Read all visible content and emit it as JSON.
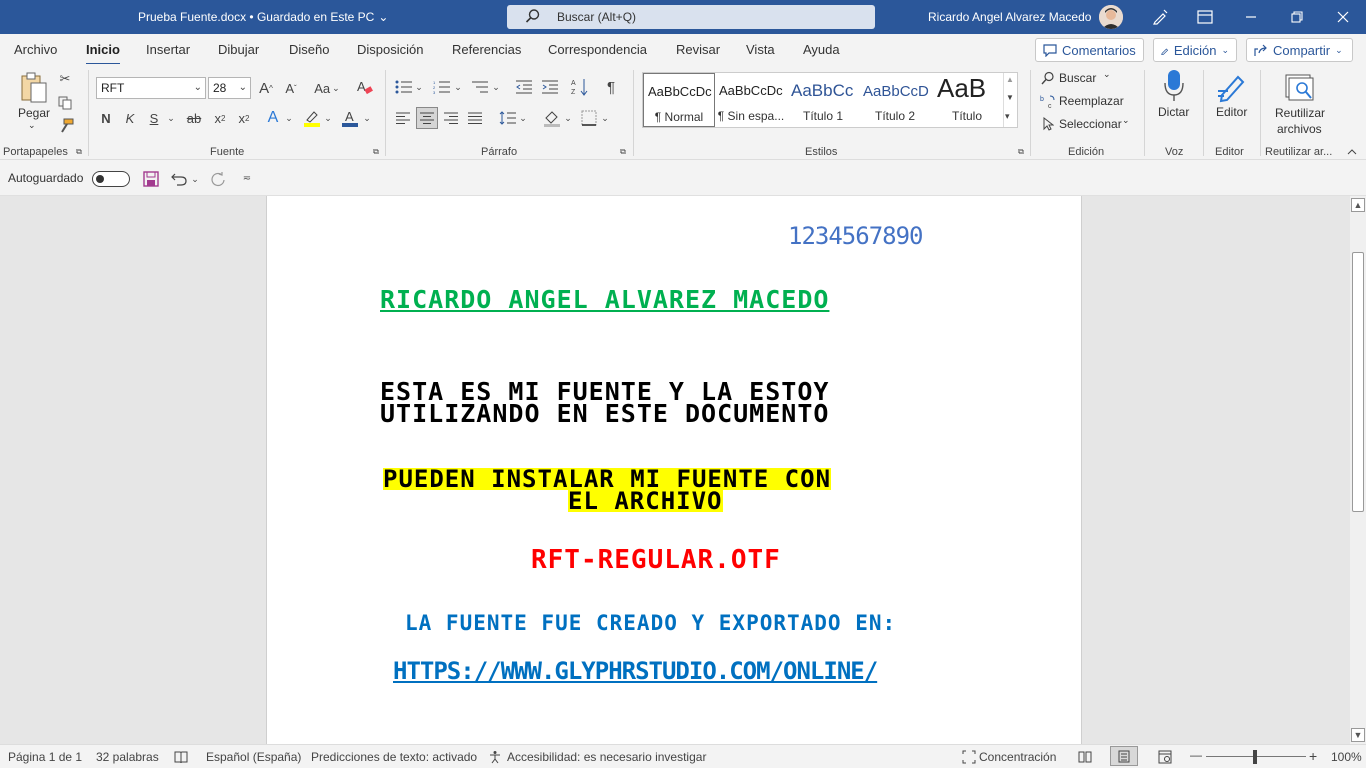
{
  "titlebar": {
    "doc_title": "Prueba Fuente.docx  •  Guardado en Este PC",
    "search_placeholder": "Buscar (Alt+Q)",
    "user_name": "Ricardo Angel Alvarez Macedo",
    "accent": "#2b579a"
  },
  "tabs": [
    "Archivo",
    "Inicio",
    "Insertar",
    "Dibujar",
    "Diseño",
    "Disposición",
    "Referencias",
    "Correspondencia",
    "Revisar",
    "Vista",
    "Ayuda"
  ],
  "tab_buttons": {
    "comments": "Comentarios",
    "editing": "Edición",
    "share": "Compartir"
  },
  "ribbon": {
    "clipboard": {
      "paste": "Pegar",
      "label": "Portapapeles"
    },
    "font": {
      "name": "RFT",
      "size": "28",
      "label": "Fuente",
      "change_case": "Aa"
    },
    "paragraph": {
      "label": "Párrafo"
    },
    "styles": {
      "label": "Estilos",
      "items": [
        {
          "sample": "AaBbCcDc",
          "name": "¶ Normal"
        },
        {
          "sample": "AaBbCcDc",
          "name": "¶ Sin espa..."
        },
        {
          "sample": "AaBbCc",
          "name": "Título 1"
        },
        {
          "sample": "AaBbCcD",
          "name": "Título 2"
        },
        {
          "sample": "AaB",
          "name": "Título"
        }
      ]
    },
    "editing": {
      "find": "Buscar",
      "replace": "Reemplazar",
      "select": "Seleccionar",
      "label": "Edición"
    },
    "voice": {
      "dictate": "Dictar",
      "label": "Voz"
    },
    "editor": {
      "button": "Editor",
      "label": "Editor"
    },
    "reuse": {
      "button_l1": "Reutilizar",
      "button_l2": "archivos",
      "label": "Reutilizar ar..."
    }
  },
  "qat": {
    "autosave": "Autoguardado"
  },
  "document": {
    "numbers": "1234567890",
    "author": "Ricardo Angel Alvarez Macedo",
    "para1_l1": "Esta es mi fuente y la estoy",
    "para1_l2": "utilizando en este documento",
    "para2_l1": "Pueden instalar mi fuente con",
    "para2_l2": "el archivo",
    "filename": "RFT-Regular.otf",
    "created": "La fuente fue creado y exportado en:",
    "url": "https://www.glyphrstudio.com/online/",
    "colors": {
      "blue": "#4472c4",
      "green": "#00b050",
      "red": "#ff0000",
      "dark_blue": "#0070c0",
      "highlight": "#ffff00"
    }
  },
  "statusbar": {
    "page": "Página 1 de 1",
    "words": "32 palabras",
    "language": "Español (España)",
    "predictions": "Predicciones de texto: activado",
    "accessibility": "Accesibilidad: es necesario investigar",
    "focus": "Concentración",
    "zoom": "100%"
  }
}
